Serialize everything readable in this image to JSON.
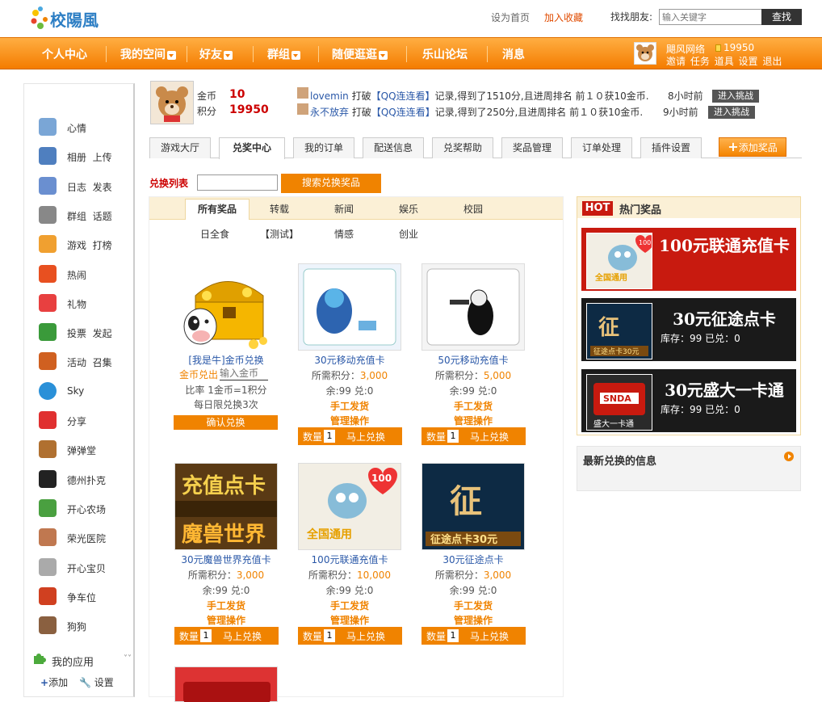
{
  "top": {
    "logo_text": "校陽風",
    "set_home": "设为首页",
    "add_fav": "加入收藏",
    "find_friend": "找找朋友:",
    "search_placeholder": "输入关键字",
    "search_btn": "查找"
  },
  "nav": {
    "items": [
      "个人中心",
      "我的空间",
      "好友",
      "群组",
      "随便逛逛",
      "乐山论坛",
      "消息"
    ]
  },
  "user": {
    "name": "飓风网络",
    "coins": "19950",
    "links": [
      "邀请",
      "任务",
      "道具",
      "设置",
      "退出"
    ]
  },
  "sidebar": {
    "items": [
      "心情",
      "相册  上传",
      "日志  发表",
      "群组  话题",
      "游戏  打榜",
      "热闹",
      "礼物",
      "投票  发起",
      "活动  召集",
      "Sky",
      "分享",
      "弹弹堂",
      "德州扑克",
      "开心农场",
      "荣光医院",
      "开心宝贝",
      "争车位",
      "狗狗"
    ],
    "my_apps": "我的应用",
    "add": "添加",
    "settings": "设置"
  },
  "profile": {
    "gold_label": "金币",
    "gold_value": "10",
    "points_label": "积分",
    "points_value": "19950"
  },
  "feed": [
    {
      "user": "lovemin",
      "action": " 打破",
      "game": "【QQ连连看】",
      "text": "记录,得到了1510分,且进周排名 前１０获10金币.",
      "time": "8小时前",
      "btn": "进入挑战"
    },
    {
      "user": "永不放弃",
      "action": " 打破",
      "game": "【QQ连连看】",
      "text": "记录,得到了250分,且进周排名 前１０获10金币.",
      "time": "9小时前",
      "btn": "进入挑战"
    }
  ],
  "tabs": [
    "游戏大厅",
    "兑奖中心",
    "我的订单",
    "配送信息",
    "兑奖帮助",
    "奖品管理",
    "订单处理",
    "插件设置"
  ],
  "add_prize": "添加奖品",
  "exchange": {
    "label": "兑换列表",
    "search_btn": "搜索兑换奖品"
  },
  "categories_row1": [
    "所有奖品",
    "转载",
    "新闻",
    "娱乐",
    "校园"
  ],
  "categories_row2": [
    "日全食",
    "【测试】",
    "情感",
    "创业"
  ],
  "special": {
    "name": "[我是牛]金币兑换",
    "label": "金币兑出",
    "input_placeholder": "输入金币",
    "ratio": "比率  1金币=1积分",
    "limit": "每日限兑换3次",
    "btn": "确认兑换"
  },
  "product_text": {
    "points_label": "所需积分：",
    "stock": "余:99  兑:0",
    "ship": "手工发货",
    "manage": "管理操作",
    "qty": "数量",
    "qty_value": "1",
    "buy": "马上兑换"
  },
  "products": [
    {
      "name": "30元移动充值卡",
      "points": "3,000"
    },
    {
      "name": "50元移动充值卡",
      "points": "5,000"
    },
    {
      "name": "30元魔兽世界充值卡",
      "points": "3,000"
    },
    {
      "name": "100元联通充值卡",
      "points": "10,000"
    },
    {
      "name": "30元征途点卡",
      "points": "3,000"
    }
  ],
  "hot": {
    "badge": "HOT",
    "title": "热门奖品",
    "items": [
      {
        "name": "100元联通充值卡",
        "stock": ""
      },
      {
        "name": "30元征途点卡",
        "stock": "库存：99 已兑：0"
      },
      {
        "name": "30元盛大一卡通",
        "stock": "库存：99 已兑：0"
      }
    ]
  },
  "latest": {
    "title": "最新兑换的信息"
  },
  "colors": {
    "accent": "#f08300",
    "nav": "#f47c00",
    "red": "#c81a0f"
  }
}
